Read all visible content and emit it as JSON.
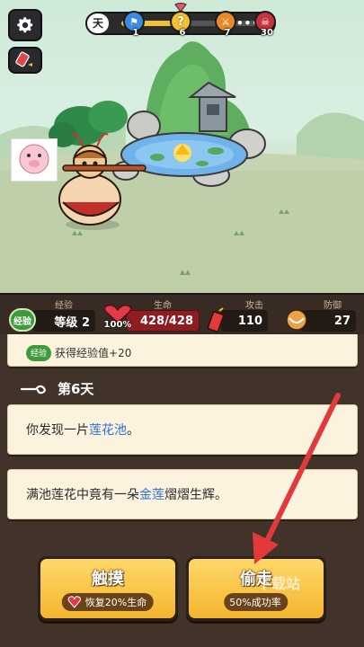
{
  "top": {
    "day_char": "天",
    "progress_fraction": 0.48,
    "nodes": [
      {
        "icon": "blue-flag-icon",
        "count": "1",
        "color": "#3d8be0"
      },
      {
        "icon": "question-mark-icon",
        "count": "6",
        "color": "#f2c12e"
      },
      {
        "icon": "crossed-swords-icon",
        "count": "7",
        "color": "#e98a2a"
      },
      {
        "icon": "demon-face-icon",
        "count": "30",
        "color": "#c8323c"
      }
    ],
    "ellipsis": "•••"
  },
  "stats": {
    "exp_title": "经验",
    "exp_badge": "经验",
    "level_text": "等级 2",
    "hp_title": "生命",
    "hp_percent": "100%",
    "hp_value": "428/428",
    "hp_fraction": 1.0,
    "atk_title": "攻击",
    "atk_value": "110",
    "def_title": "防御",
    "def_value": "27"
  },
  "log": {
    "exp_badge": "经验",
    "exp_gain": "获得经验值+20",
    "day_heading": "第6天",
    "card1_prefix": "你发现一片",
    "card1_highlight": "莲花池",
    "card1_suffix": "。",
    "card2_prefix": "满池莲花中竟有一朵",
    "card2_highlight": "金莲",
    "card2_suffix": "熠熠生辉。"
  },
  "actions": [
    {
      "title": "触摸",
      "sub": "恢复20%生命",
      "icon": "heart-icon"
    },
    {
      "title": "偷走",
      "sub": "50%成功率"
    }
  ],
  "watermark": "下载站",
  "colors": {
    "accent": "#f3b52d",
    "hp": "#8e1d22",
    "exp": "#3f9a3a",
    "highlight": "#2f6fd1",
    "arrow": "#e23a3a"
  }
}
